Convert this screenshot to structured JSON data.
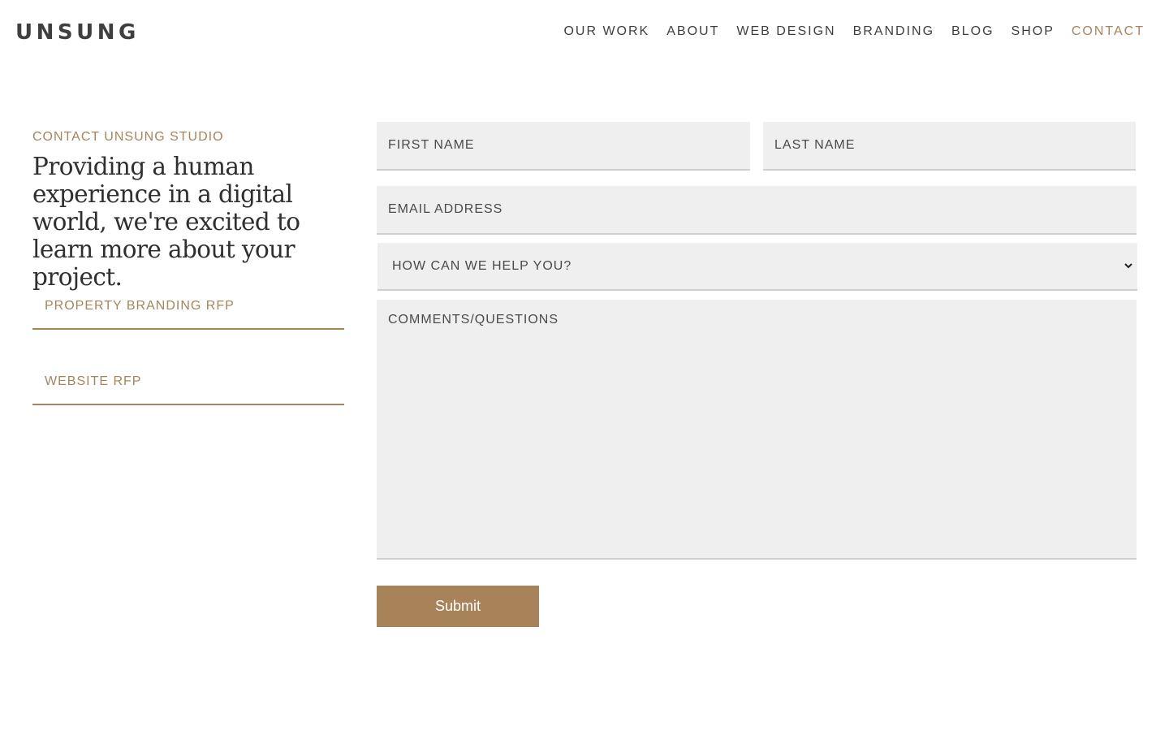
{
  "header": {
    "logo": "UNSUNG",
    "nav": [
      {
        "label": "OUR WORK"
      },
      {
        "label": "ABOUT"
      },
      {
        "label": "WEB DESIGN"
      },
      {
        "label": "BRANDING"
      },
      {
        "label": "BLOG"
      },
      {
        "label": "SHOP"
      },
      {
        "label": "CONTACT",
        "active": true
      }
    ]
  },
  "intro": {
    "eyebrow": "CONTACT UNSUNG STUDIO",
    "headline": "Providing a human experience in a digital world, we're excited to learn more about your project."
  },
  "rfp_links": [
    {
      "label": "PROPERTY BRANDING RFP"
    },
    {
      "label": "WEBSITE RFP"
    }
  ],
  "form": {
    "first_name": {
      "placeholder": "FIRST NAME",
      "value": ""
    },
    "last_name": {
      "placeholder": "LAST NAME",
      "value": ""
    },
    "email": {
      "placeholder": "EMAIL ADDRESS",
      "value": ""
    },
    "help_select": {
      "selected": "HOW CAN WE HELP YOU?"
    },
    "comments": {
      "placeholder": "COMMENTS/QUESTIONS",
      "value": ""
    },
    "submit_label": "Submit"
  },
  "colors": {
    "accent": "#a8845a",
    "field_bg": "#efefef",
    "text": "#3f3f3f"
  },
  "icons": {
    "select_arrow": "chevron-down-icon"
  }
}
